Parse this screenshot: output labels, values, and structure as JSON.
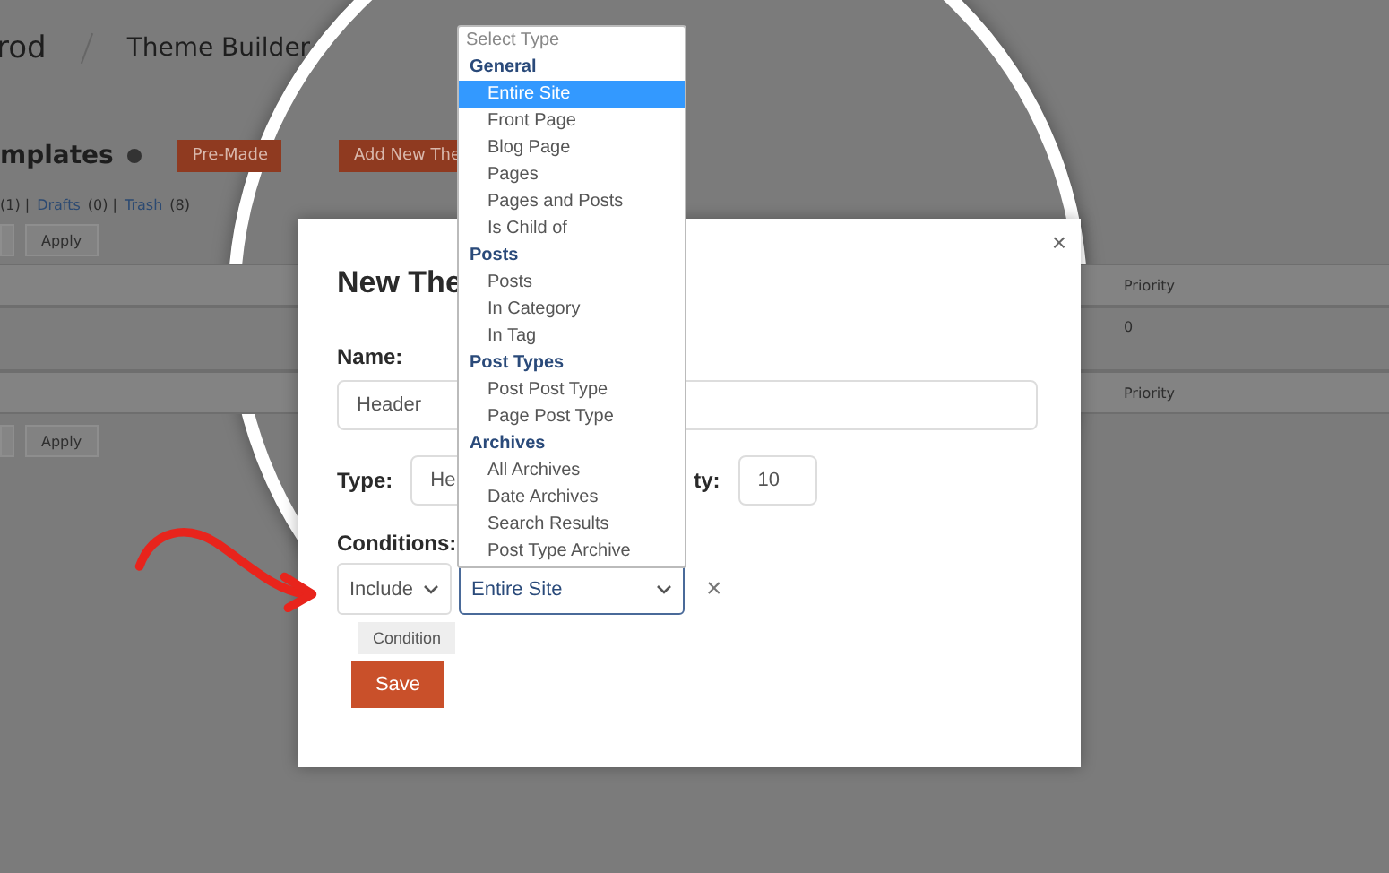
{
  "header": {
    "brand": "rod",
    "title": "Theme Builder"
  },
  "page": {
    "heading": "mplates",
    "buttons": [
      "Pre-Made",
      "Add New The"
    ],
    "filters": [
      {
        "kind": "text",
        "text": "(1) |"
      },
      {
        "kind": "link",
        "text": "Drafts"
      },
      {
        "kind": "text",
        "text": "(0) |"
      },
      {
        "kind": "link",
        "text": "Trash"
      },
      {
        "kind": "text",
        "text": "(8)"
      }
    ],
    "apply_top": "Apply",
    "table_header": "Priority",
    "table_row": "0",
    "table_footer": "Priority",
    "apply_bottom": "Apply"
  },
  "modal": {
    "close": "×",
    "remove": "×",
    "title": "New The",
    "name_label": "Name:",
    "name_value": "Header",
    "type_label": "Type:",
    "type_value": "He",
    "priority_label": "ty:",
    "priority_value": "10",
    "conditions_label": "Conditions:",
    "include": "Include",
    "target": "Entire Site",
    "add_condition": "Condition",
    "save": "Save"
  },
  "dropdown": {
    "placeholder": "Select Type",
    "groups": [
      {
        "label": "General",
        "items": [
          {
            "label": "Entire Site",
            "selected": true
          },
          {
            "label": "Front Page",
            "selected": false
          },
          {
            "label": "Blog Page",
            "selected": false
          },
          {
            "label": "Pages",
            "selected": false
          },
          {
            "label": "Pages and Posts",
            "selected": false
          },
          {
            "label": "Is Child of",
            "selected": false
          }
        ]
      },
      {
        "label": "Posts",
        "items": [
          {
            "label": "Posts",
            "selected": false
          },
          {
            "label": "In Category",
            "selected": false
          },
          {
            "label": "In Tag",
            "selected": false
          }
        ]
      },
      {
        "label": "Post Types",
        "items": [
          {
            "label": "Post Post Type",
            "selected": false
          },
          {
            "label": "Page Post Type",
            "selected": false
          }
        ]
      },
      {
        "label": "Archives",
        "items": [
          {
            "label": "All Archives",
            "selected": false
          },
          {
            "label": "Date Archives",
            "selected": false
          },
          {
            "label": "Search Results",
            "selected": false
          },
          {
            "label": "Post Type Archive",
            "selected": false
          }
        ]
      }
    ]
  }
}
